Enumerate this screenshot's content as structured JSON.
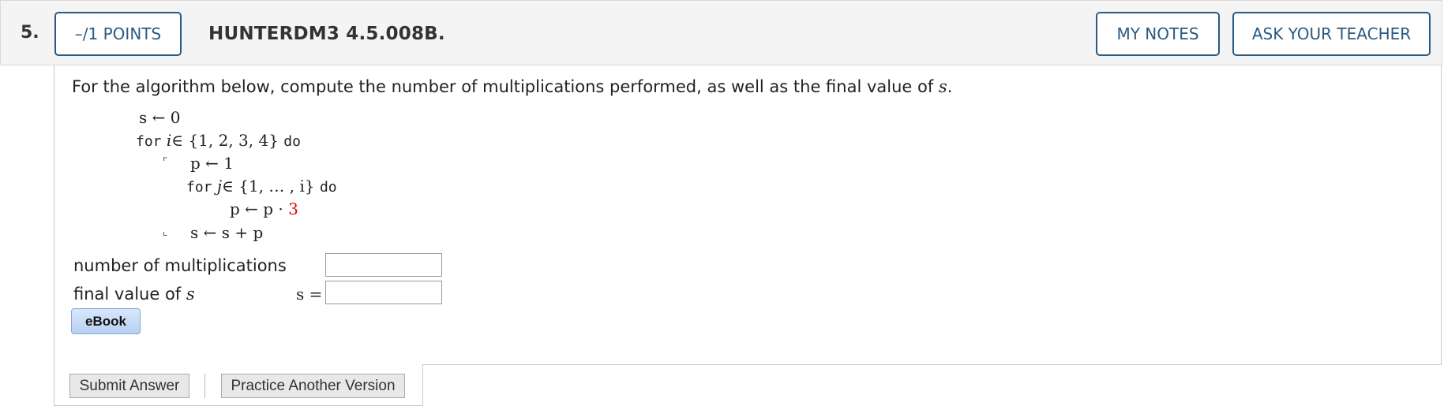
{
  "header": {
    "question_number": "5.",
    "points_label": "–/1 POINTS",
    "question_id": "HUNTERDM3 4.5.008B.",
    "my_notes_label": "MY NOTES",
    "ask_teacher_label": "ASK YOUR TEACHER"
  },
  "prompt": {
    "text": "For the algorithm below, compute the number of multiplications performed, as well as the final value of ",
    "var": "s",
    "end": "."
  },
  "algorithm": {
    "line1": "s ← 0",
    "for_kw": "for",
    "line2_var": "i",
    "line2_set": "∈ {1, 2, 3, 4}",
    "do_kw": "do",
    "line3": "p ← 1",
    "inner_for_kw": "for",
    "line4_var": "j",
    "line4_set": "∈ {1, … , i}",
    "inner_do_kw": "do",
    "line5": "p ← p · ",
    "line5_const": "3",
    "line6": "s ← s + p"
  },
  "answers": {
    "multiplications_label": "number of multiplications",
    "final_value_label": "final value of ",
    "final_value_var": "s",
    "s_equals": "s =",
    "multiplications_value": "",
    "final_value": ""
  },
  "ebook_label": "eBook",
  "footer": {
    "submit_label": "Submit Answer",
    "practice_label": "Practice Another Version"
  }
}
